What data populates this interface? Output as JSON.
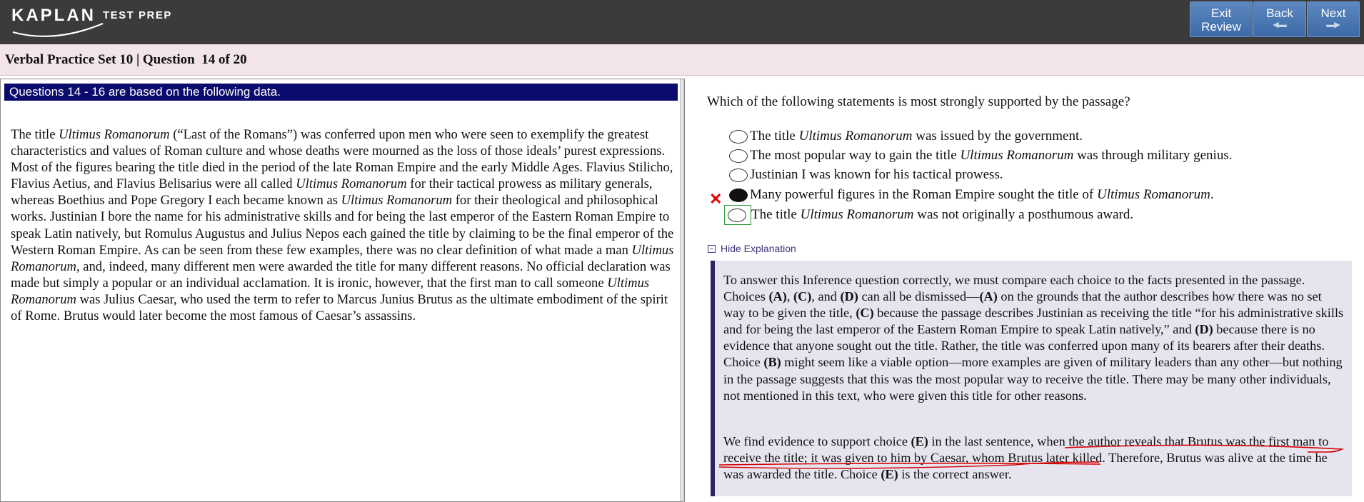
{
  "header": {
    "logo_main": "KAPLAN",
    "logo_sub": "TEST PREP",
    "buttons": {
      "exit_line1": "Exit",
      "exit_line2": "Review",
      "back": "Back",
      "next": "Next"
    }
  },
  "question_bar": {
    "title": "Verbal Practice Set 10 | Question  14 of 20"
  },
  "passage": {
    "header": "Questions 14 - 16 are based on the following data.",
    "segments": [
      "The title ",
      "Ultimus Romanorum",
      " (“Last of the Romans”) was conferred upon men who were seen to exemplify the greatest characteristics and values of Roman culture and whose deaths were mourned as the loss of those ideals’ purest expressions. Most of the figures bearing the title died in the period of the late Roman Empire and the early Middle Ages. Flavius Stilicho, Flavius Aetius, and Flavius Belisarius were all called ",
      "Ultimus Romanorum",
      " for their tactical prowess as military generals, whereas Boethius and Pope Gregory I each became known as ",
      "Ultimus Romanorum",
      " for their theological and philosophical works. Justinian I bore the name for his administrative skills and for being the last emperor of the Eastern Roman Empire to speak Latin natively, but Romulus Augustus and Julius Nepos each gained the title by claiming to be the final emperor of the Western Roman Empire. As can be seen from these few examples, there was no clear definition of what made a man ",
      "Ultimus Romanorum",
      ", and, indeed, many different men were awarded the title for many different reasons. No official declaration was made but simply a popular or an individual acclamation. It is ironic, however, that the first man to call someone ",
      "Ultimus Romanorum",
      " was Julius Caesar, who used the term to refer to Marcus Junius Brutus as the ultimate embodiment of the spirit of Rome. Brutus would later become the most famous of Caesar’s assassins."
    ]
  },
  "question": {
    "prompt": "Which of the following statements is most strongly supported by the passage?",
    "choices": [
      {
        "before": "The title ",
        "italic": "Ultimus Romanorum",
        "after": " was issued by the government.",
        "state": "unselected"
      },
      {
        "before": "The most popular way to gain the title ",
        "italic": "Ultimus Romanorum",
        "after": " was through military genius.",
        "state": "unselected"
      },
      {
        "before": "Justinian I was known for his tactical prowess.",
        "italic": "",
        "after": "",
        "state": "unselected"
      },
      {
        "before": "Many powerful figures in the Roman Empire sought the title of ",
        "italic": "Ultimus Romanorum",
        "after": ".",
        "state": "selected-wrong"
      },
      {
        "before": "The title ",
        "italic": "Ultimus Romanorum",
        "after": " was not originally a posthumous award.",
        "state": "correct"
      }
    ],
    "wrong_mark": "✕",
    "colors": {
      "wrong": "#e00000",
      "correct": "#2d9a3a",
      "navy": "#0b0b6e"
    }
  },
  "explanation": {
    "toggle_label": "Hide Explanation",
    "toggle_symbol": "−",
    "p1": [
      {
        "t": "To answer this Inference question correctly, we must compare each choice to the facts presented in the passage. Choices "
      },
      {
        "b": "(A)"
      },
      {
        "t": ", "
      },
      {
        "b": "(C)"
      },
      {
        "t": ", and "
      },
      {
        "b": "(D)"
      },
      {
        "t": " can all be dismissed—"
      },
      {
        "b": "(A)"
      },
      {
        "t": " on the grounds that the author describes how there was no set way to be given the title, "
      },
      {
        "b": "(C)"
      },
      {
        "t": " because the passage describes Justinian as receiving the title “for his administrative skills and for being the last emperor of the Eastern Roman Empire to speak Latin natively,” and "
      },
      {
        "b": "(D)"
      },
      {
        "t": " because there is no evidence that anyone sought out the title. Rather, the title was conferred upon many of its bearers after their deaths. Choice "
      },
      {
        "b": "(B)"
      },
      {
        "t": " might seem like a viable option—more examples are given of military leaders than any other—but nothing in the passage suggests that this was the most popular way to receive the title. There may be many other individuals, not mentioned in this text, who were given this title for other reasons."
      }
    ],
    "p2": [
      {
        "t": "We find evidence to support choice "
      },
      {
        "b": "(E)"
      },
      {
        "t": " in the last sentence, when the author reveals that Brutus was the first man to receive the title; it was given to him by Caesar, whom Brutus later killed. Therefore, Brutus was alive at the time he was awarded the title. Choice "
      },
      {
        "b": "(E)"
      },
      {
        "t": " is the correct answer."
      }
    ]
  }
}
